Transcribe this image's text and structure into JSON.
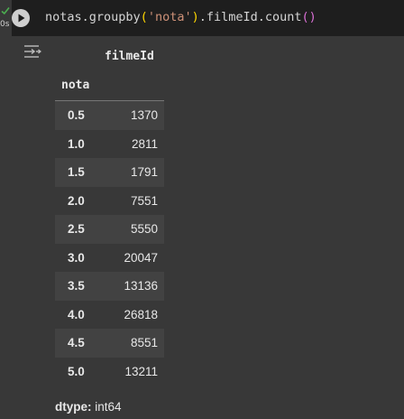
{
  "cell": {
    "exec_time": "0s",
    "code": {
      "prefix": "notas.groupby",
      "open_paren": "(",
      "arg": "'nota'",
      "close_paren": ")",
      "middle": ".filmeId.count",
      "call_parens": "()"
    }
  },
  "output": {
    "column_header": "filmeId",
    "index_header": "nota",
    "rows": [
      {
        "index": "0.5",
        "value": "1370"
      },
      {
        "index": "1.0",
        "value": "2811"
      },
      {
        "index": "1.5",
        "value": "1791"
      },
      {
        "index": "2.0",
        "value": "7551"
      },
      {
        "index": "2.5",
        "value": "5550"
      },
      {
        "index": "3.0",
        "value": "20047"
      },
      {
        "index": "3.5",
        "value": "13136"
      },
      {
        "index": "4.0",
        "value": "26818"
      },
      {
        "index": "4.5",
        "value": "8551"
      },
      {
        "index": "5.0",
        "value": "13211"
      }
    ],
    "dtype_label": "dtype:",
    "dtype_value": "int64"
  },
  "colors": {
    "check": "#4caf50",
    "background": "#383838",
    "code_background": "#1e1e1e",
    "stripe": "#424242"
  },
  "icons": {
    "exec_status": "check-icon",
    "run": "play-icon",
    "output_actions": "output-actions-icon"
  }
}
